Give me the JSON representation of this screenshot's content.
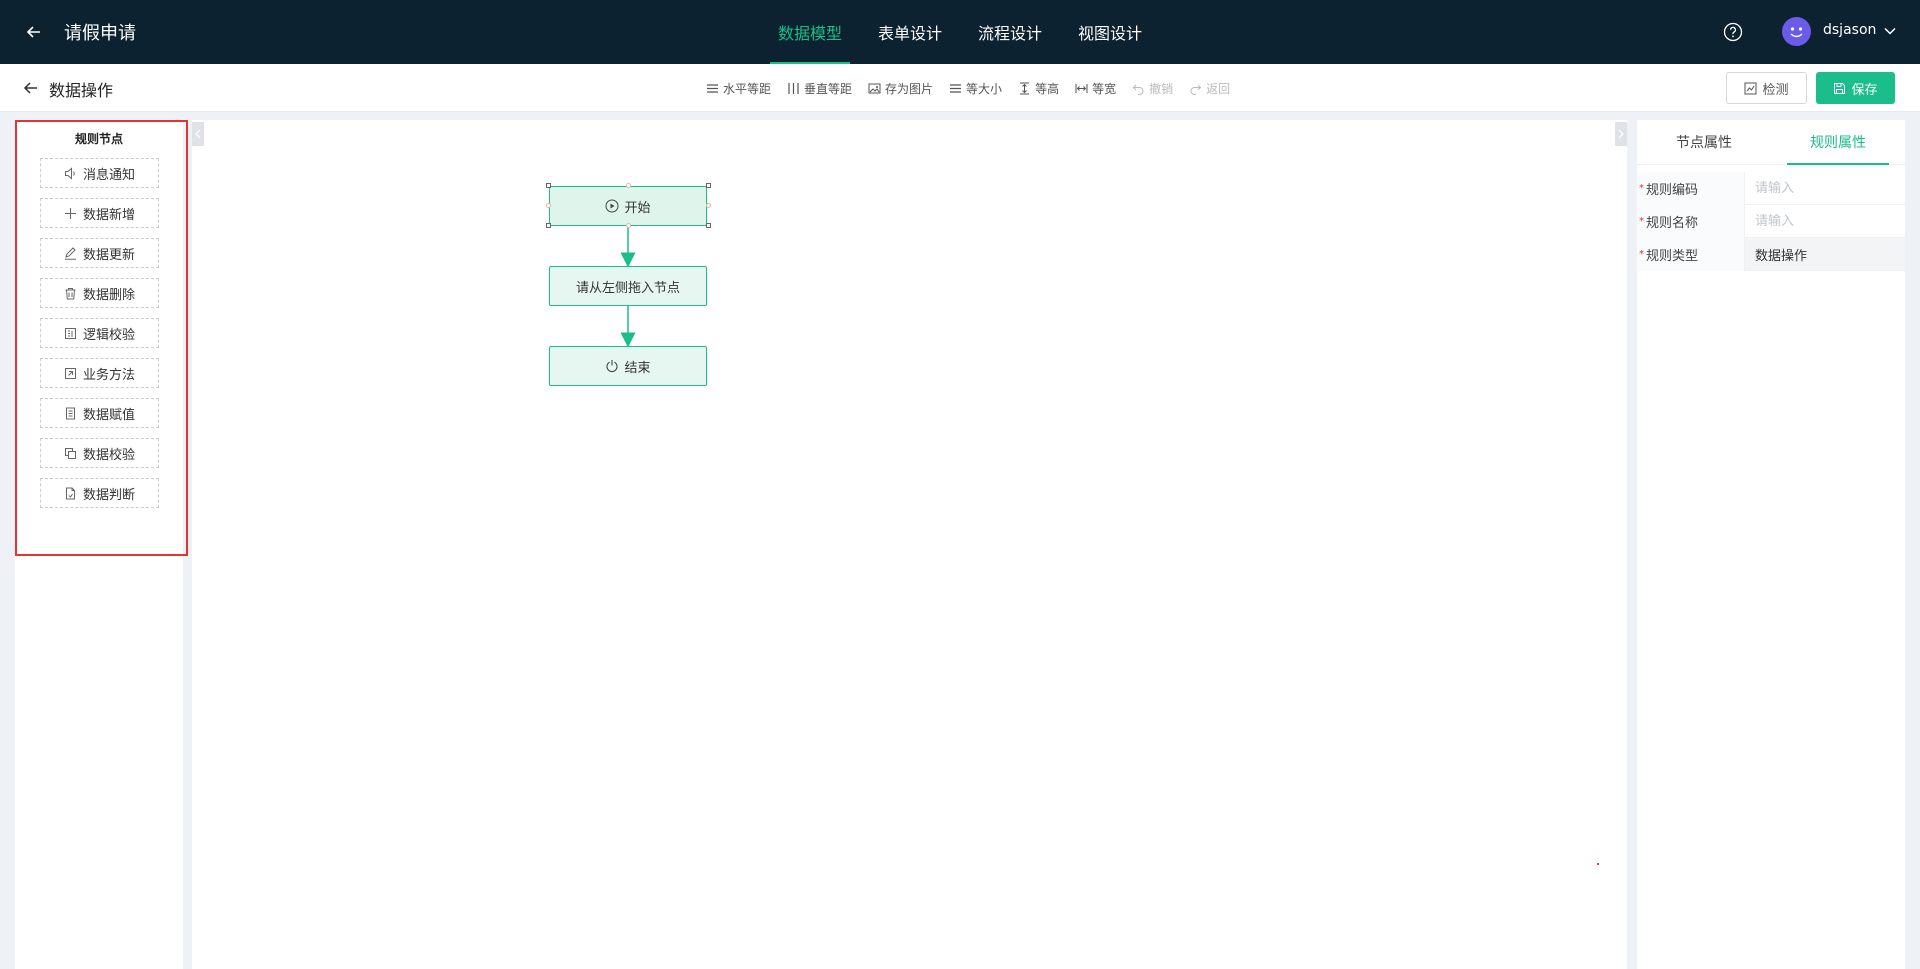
{
  "header": {
    "title": "请假申请",
    "tabs": [
      {
        "label": "数据模型",
        "active": true
      },
      {
        "label": "表单设计",
        "active": false
      },
      {
        "label": "流程设计",
        "active": false
      },
      {
        "label": "视图设计",
        "active": false
      }
    ],
    "username": "dsjason"
  },
  "subbar": {
    "title": "数据操作",
    "tools": [
      {
        "label": "水平等距",
        "icon": "horizontal-spacing-icon",
        "disabled": false
      },
      {
        "label": "垂直等距",
        "icon": "vertical-spacing-icon",
        "disabled": false
      },
      {
        "label": "存为图片",
        "icon": "image-icon",
        "disabled": false
      },
      {
        "label": "等大小",
        "icon": "same-size-icon",
        "disabled": false
      },
      {
        "label": "等高",
        "icon": "same-height-icon",
        "disabled": false
      },
      {
        "label": "等宽",
        "icon": "same-width-icon",
        "disabled": false
      },
      {
        "label": "撤销",
        "icon": "undo-icon",
        "disabled": true
      },
      {
        "label": "返回",
        "icon": "redo-icon",
        "disabled": true
      }
    ],
    "check_label": "检测",
    "save_label": "保存"
  },
  "palette": {
    "title": "规则节点",
    "items": [
      {
        "label": "消息通知",
        "icon": "speaker-icon"
      },
      {
        "label": "数据新增",
        "icon": "plus-icon"
      },
      {
        "label": "数据更新",
        "icon": "edit-icon"
      },
      {
        "label": "数据删除",
        "icon": "trash-icon"
      },
      {
        "label": "逻辑校验",
        "icon": "logic-icon"
      },
      {
        "label": "业务方法",
        "icon": "method-icon"
      },
      {
        "label": "数据赋值",
        "icon": "document-icon"
      },
      {
        "label": "数据校验",
        "icon": "copy-icon"
      },
      {
        "label": "数据判断",
        "icon": "file-icon"
      }
    ]
  },
  "flow": {
    "start_label": "开始",
    "placeholder_label": "请从左侧拖入节点",
    "end_label": "结束"
  },
  "properties": {
    "tabs": [
      {
        "label": "节点属性",
        "active": false
      },
      {
        "label": "规则属性",
        "active": true
      }
    ],
    "fields": [
      {
        "label": "规则编码",
        "placeholder": "请输入",
        "value": "",
        "required": true
      },
      {
        "label": "规则名称",
        "placeholder": "请输入",
        "value": "",
        "required": true
      },
      {
        "label": "规则类型",
        "value": "数据操作",
        "required": true
      }
    ]
  },
  "colors": {
    "header_bg": "#0c2231",
    "accent": "#1bbd8a",
    "highlight_border": "#e53232"
  }
}
